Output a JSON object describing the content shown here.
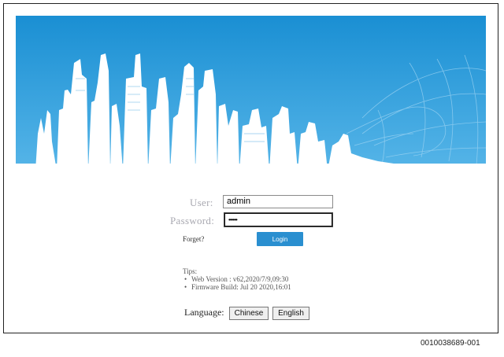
{
  "login": {
    "user_label": "User:",
    "user_value": "admin",
    "password_label": "Password:",
    "password_mask": "••••••",
    "forget_label": "Forget?",
    "login_label": "Login"
  },
  "tips": {
    "title": "Tips:",
    "items": [
      "Web Version : v62,2020/7/9,09:30",
      "Firmware Build: Jul 20 2020,16:01"
    ]
  },
  "language": {
    "label": "Language:",
    "options": [
      "Chinese",
      "English"
    ]
  },
  "figure_id": "0010038689-001",
  "colors": {
    "banner_sky": "#1f93d6",
    "login_button": "#2a8fd0",
    "label_gray": "#a9a9b1"
  },
  "icons": {
    "bullet": "•"
  }
}
